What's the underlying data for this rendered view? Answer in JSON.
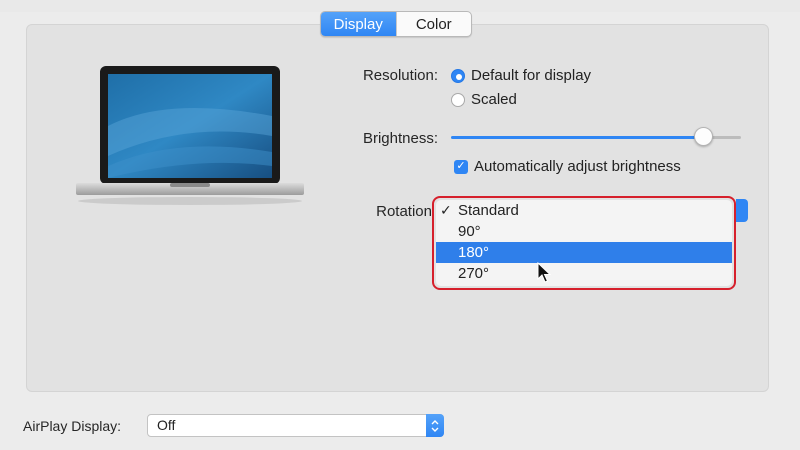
{
  "tabs": [
    {
      "label": "Display",
      "active": true
    },
    {
      "label": "Color",
      "active": false
    }
  ],
  "resolution": {
    "label": "Resolution:",
    "options": [
      {
        "label": "Default for display",
        "selected": true
      },
      {
        "label": "Scaled",
        "selected": false
      }
    ]
  },
  "brightness": {
    "label": "Brightness:",
    "value_fraction": 0.87,
    "auto_adjust": {
      "label": "Automatically adjust brightness",
      "checked": true
    }
  },
  "rotation": {
    "label": "Rotation",
    "menu_items": [
      {
        "label": "Standard",
        "checked": true,
        "highlighted": false
      },
      {
        "label": "90°",
        "checked": false,
        "highlighted": false
      },
      {
        "label": "180°",
        "checked": false,
        "highlighted": true
      },
      {
        "label": "270°",
        "checked": false,
        "highlighted": false
      }
    ]
  },
  "airplay": {
    "label": "AirPlay Display:",
    "value": "Off"
  },
  "icons": {
    "laptop": "laptop-illustration",
    "cursor": "mouse-pointer-icon",
    "check": "checkmark-icon",
    "stepper": "up-down-chevron-icon"
  },
  "colors": {
    "accent": "#2f86f4",
    "highlight_border": "#d6202c",
    "panel_bg": "#e2e2e2"
  }
}
